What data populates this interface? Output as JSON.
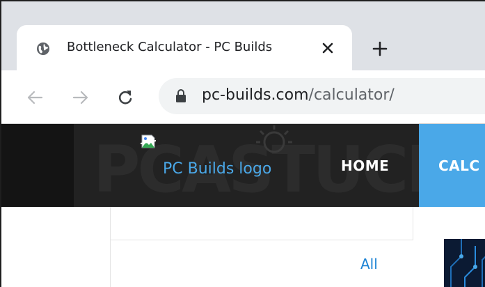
{
  "browser": {
    "tab": {
      "title": "Bottleneck Calculator - PC Builds",
      "favicon": "globe-icon",
      "close_icon": "close-icon"
    },
    "new_tab_icon": "plus-icon",
    "toolbar": {
      "back_icon": "arrow-left-icon",
      "forward_icon": "arrow-right-icon",
      "reload_icon": "reload-icon",
      "lock_icon": "lock-icon",
      "url_host": "pc-builds.com",
      "url_path": "/calculator/"
    },
    "colors": {
      "tabstrip": "#dee1e6",
      "omnibox": "#f1f3f4"
    }
  },
  "site": {
    "header": {
      "logo_alt": "PC Builds logo",
      "watermark": "PCASTUCES",
      "nav": [
        {
          "label": "HOME"
        },
        {
          "label": "CALC"
        }
      ],
      "colors": {
        "header_bg": "#222222",
        "accent": "#4aa8e8"
      }
    },
    "content": {
      "filter_label": "All"
    }
  }
}
